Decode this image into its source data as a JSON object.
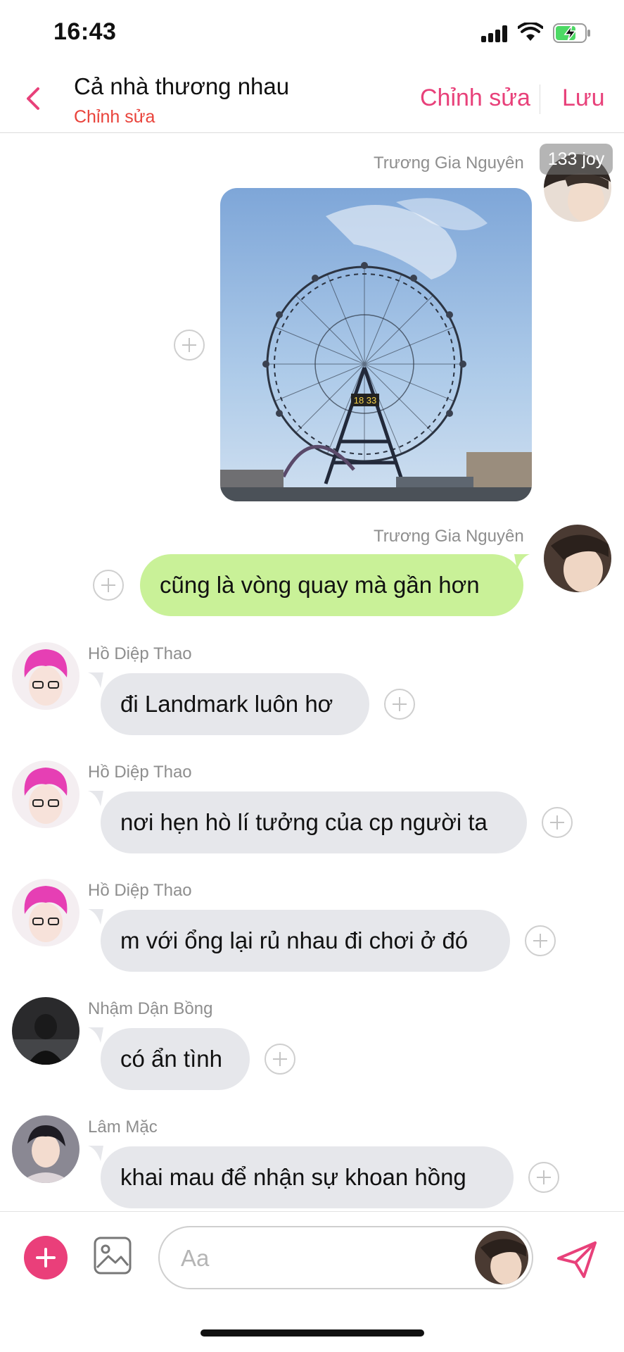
{
  "status_bar": {
    "time": "16:43",
    "icons": [
      "signal-icon",
      "wifi-icon",
      "battery-charging-icon"
    ]
  },
  "header": {
    "back_icon": "chevron-left-icon",
    "title": "Cả nhà thương nhau",
    "subtitle": "Chỉnh sửa",
    "edit_label": "Chỉnh sửa",
    "save_label": "Lưu",
    "accent_color": "#e8417a",
    "subtitle_color": "#e9423a"
  },
  "messages": [
    {
      "sender": "Trương Gia Nguyên",
      "type": "image",
      "direction": "outgoing",
      "image_caption": "18 33",
      "badge": "133 joy"
    },
    {
      "sender": "Trương Gia Nguyên",
      "type": "text",
      "direction": "outgoing",
      "text": "cũng là vòng quay mà gần hơn"
    },
    {
      "sender": "Hồ Diệp Thao",
      "type": "text",
      "direction": "incoming",
      "text": "đi Landmark luôn hơ"
    },
    {
      "sender": "Hồ Diệp Thao",
      "type": "text",
      "direction": "incoming",
      "text": "nơi hẹn hò lí tưởng của cp người ta"
    },
    {
      "sender": "Hồ Diệp Thao",
      "type": "text",
      "direction": "incoming",
      "text": "m với ổng lại rủ nhau đi chơi ở đó"
    },
    {
      "sender": "Nhậm Dận Bồng",
      "type": "text",
      "direction": "incoming",
      "text": "có ẩn tình"
    },
    {
      "sender": "Lâm Mặc",
      "type": "text",
      "direction": "incoming",
      "text": "khai mau để nhận sự khoan hồng"
    }
  ],
  "bubble_colors": {
    "incoming": "#e6e7eb",
    "outgoing": "#c9f198"
  },
  "input_bar": {
    "placeholder": "Aa",
    "value": "",
    "add_icon": "plus-circle-icon",
    "image_icon": "image-icon",
    "send_icon": "send-icon",
    "add_color": "#ea3f7a"
  }
}
